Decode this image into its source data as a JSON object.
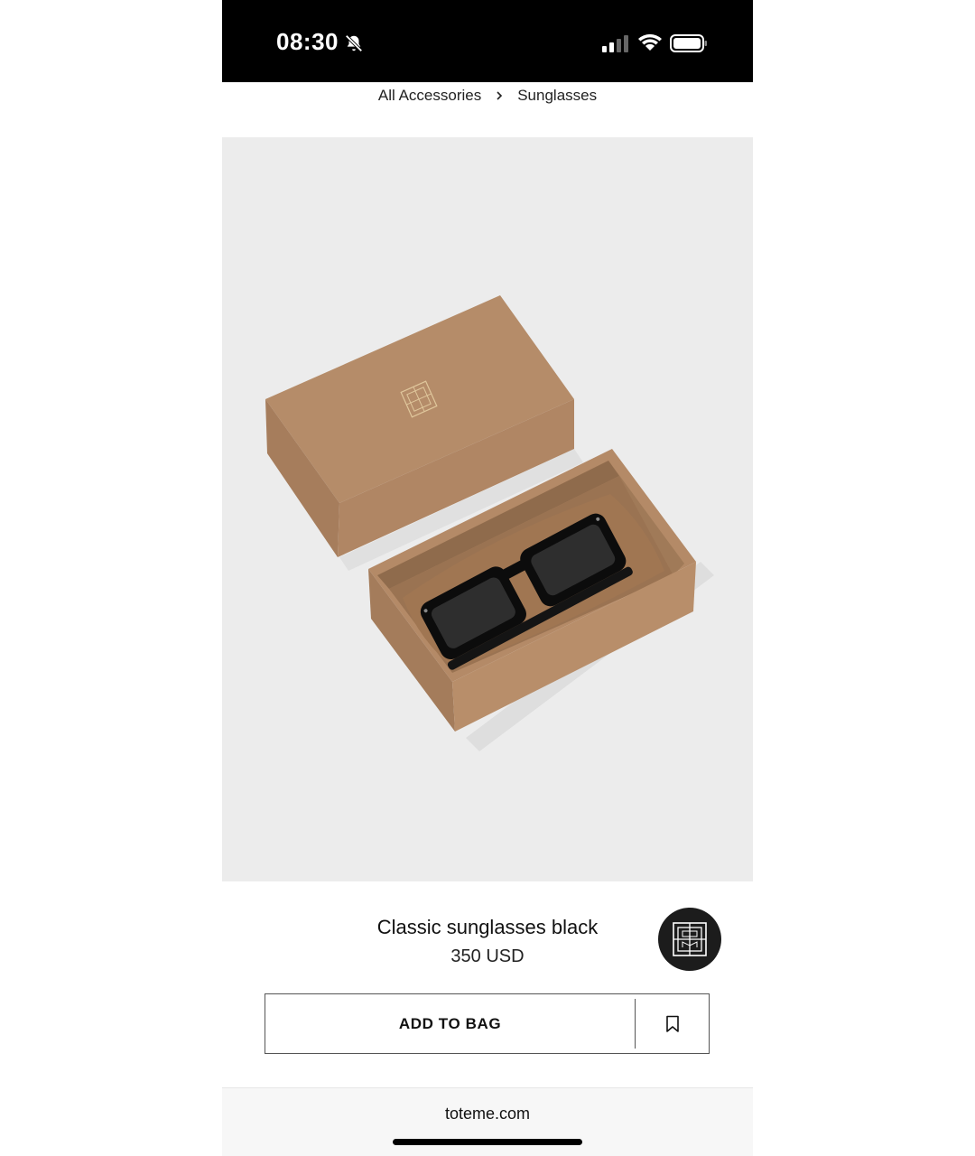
{
  "status_bar": {
    "time": "08:30"
  },
  "breadcrumb": {
    "items": [
      "All Accessories",
      "Sunglasses"
    ]
  },
  "product": {
    "title": "Classic sunglasses black",
    "price": "350 USD"
  },
  "actions": {
    "add_to_bag_label": "ADD TO BAG"
  },
  "browser": {
    "url": "toteme.com"
  },
  "colors": {
    "image_background": "#ececec",
    "box_color": "#b48a67",
    "logo_background": "#1c1c1c"
  },
  "icons": [
    "bell-slash-icon",
    "signal-icon",
    "wifi-icon",
    "battery-icon",
    "chevron-right-icon",
    "brand-monogram-icon",
    "bookmark-icon"
  ]
}
